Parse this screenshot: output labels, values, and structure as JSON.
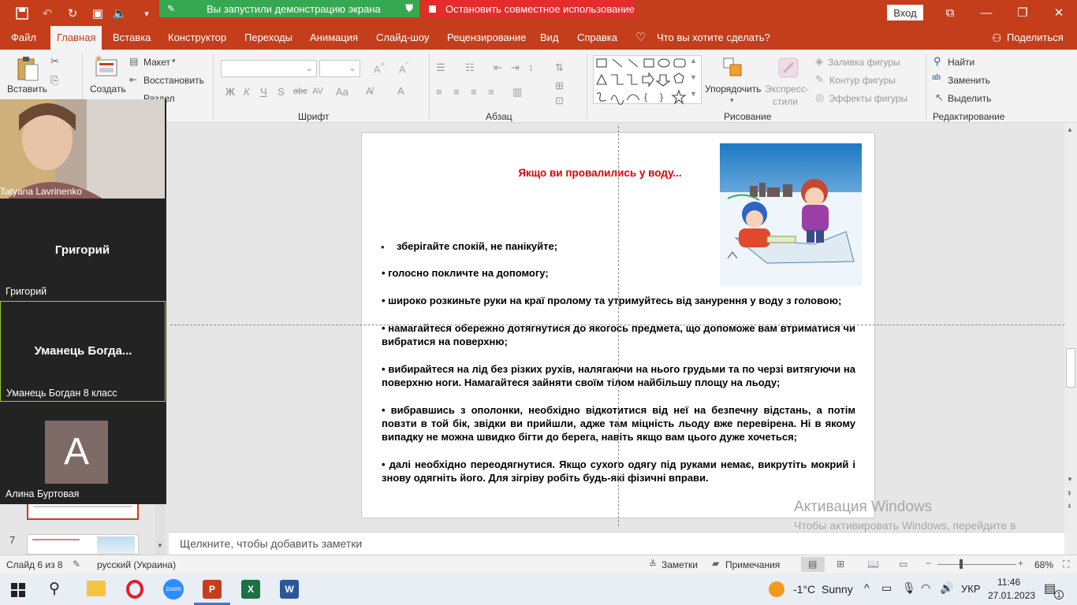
{
  "share_bar": {
    "started": "Вы запустили демонстрацию экрана",
    "stop": "Остановить совместное использование"
  },
  "titlebar": {
    "login": "Вход"
  },
  "menu": {
    "file": "Файл",
    "home": "Главная",
    "insert": "Вставка",
    "design": "Конструктор",
    "transitions": "Переходы",
    "animations": "Анимация",
    "slideshow": "Слайд-шоу",
    "review": "Рецензирование",
    "view": "Вид",
    "help": "Справка",
    "tell_me": "Что вы хотите сделать?",
    "share": "Поделиться"
  },
  "ribbon": {
    "paste": "Вставить",
    "create": "Создать",
    "layout": "Макет",
    "reset": "Восстановить",
    "section": "Раздел",
    "font_group": "Шрифт",
    "paragraph_group": "Абзац",
    "drawing_group": "Рисование",
    "editing_group": "Редактирование",
    "arrange": "Упорядочить",
    "quick_styles": "Экспресс-",
    "quick_styles2": "стили",
    "shape_fill": "Заливка фигуры",
    "shape_outline": "Контур фигуры",
    "shape_effects": "Эффекты фигуры",
    "find": "Найти",
    "replace": "Заменить",
    "select": "Выделить",
    "bold": "Ж",
    "italic": "К",
    "underline": "Ч",
    "shadow": "S",
    "strike": "abc",
    "spacing": "AV",
    "case": "Aa"
  },
  "zoom": {
    "p1_name": "Tatyana Lavrinenko",
    "p2_big": "Григорий",
    "p2_name": "Григорий",
    "p3_big": "Уманець  Богда...",
    "p3_name": "Уманець Богдан 8 класс",
    "p4_initial": "A",
    "p4_name": "Алина Буртовая"
  },
  "thumbs": {
    "slide7_num": "7"
  },
  "slide": {
    "title": "Якщо ви провалились у воду...",
    "bullet1_mark": "•",
    "b1": "зберігайте спокій, не панікуйте;",
    "b2": "• голосно покличте на допомогу;",
    "b3": "• широко розкиньте руки на краї пролому та утримуйтесь від занурення у воду з головою;",
    "b4": "• намагайтеся обережно дотягнутися до якогось предмета, що допоможе вам втриматися чи вибратися на поверхню;",
    "b5": "• вибирайтеся на лід без різких рухів, налягаючи на нього грудьми та по черзі витягуючи на поверхню ноги. Намагайтеся зайняти своїм тілом найбільшу площу на льоду;",
    "b6": "• вибравшись з ополонки, необхідно відкотитися від неї на безпечну відстань, а потім повзти в той бік, звідки ви прийшли, адже там міцність льоду вже перевірена. Ні в якому випадку не можна швидко бігти до берега, навіть якщо вам цього дуже хочеться;",
    "b7": "• далі необхідно переодягнутися. Якщо сухого одягу під руками немає, викрутіть мокрий і знову одягніть його. Для зігріву робіть будь-які фізичні вправи."
  },
  "watermark": {
    "line1": "Активация Windows",
    "line2": "Чтобы активировать Windows, перейдите в раздел \"Параметры\"."
  },
  "notes": {
    "placeholder": "Щелкните, чтобы добавить заметки"
  },
  "status": {
    "slide": "Слайд 6 из 8",
    "lang": "русский (Украина)",
    "notes": "Заметки",
    "comments": "Примечания",
    "zoom": "68%"
  },
  "taskbar": {
    "weather_temp": "-1°C",
    "weather_text": "Sunny",
    "lang": "УКР",
    "time": "11:46",
    "date": "27.01.2023",
    "notif": "1"
  },
  "colors": {
    "accent": "#c43e1c",
    "green": "#36a852",
    "red": "#e52b2b",
    "title_red": "#e00000"
  }
}
